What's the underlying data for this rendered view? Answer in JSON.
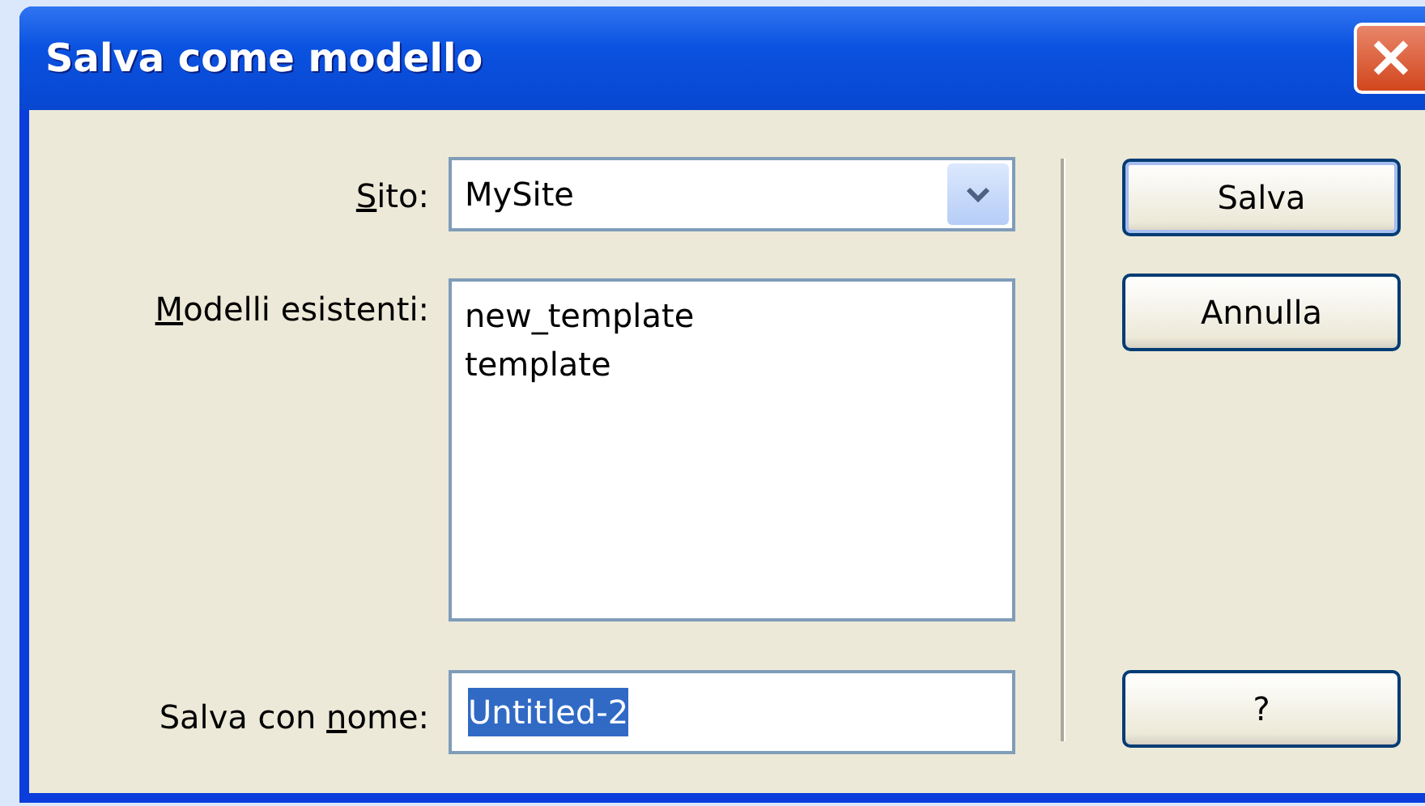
{
  "window": {
    "title": "Salva come modello",
    "close": "×"
  },
  "site": {
    "label": {
      "access": "S",
      "after": "ito:"
    },
    "value": "MySite"
  },
  "templates": {
    "label": {
      "access": "M",
      "after": "odelli esistenti:"
    },
    "items": [
      "new_template",
      "template"
    ]
  },
  "save_as": {
    "label": {
      "before": "Salva con ",
      "access": "n",
      "after": "ome:"
    },
    "value": "Untitled-2",
    "selected": true
  },
  "buttons": [
    {
      "label": "Salva",
      "default": true
    },
    {
      "label": "Annulla",
      "default": false
    },
    {
      "label": "?",
      "default": false
    }
  ]
}
